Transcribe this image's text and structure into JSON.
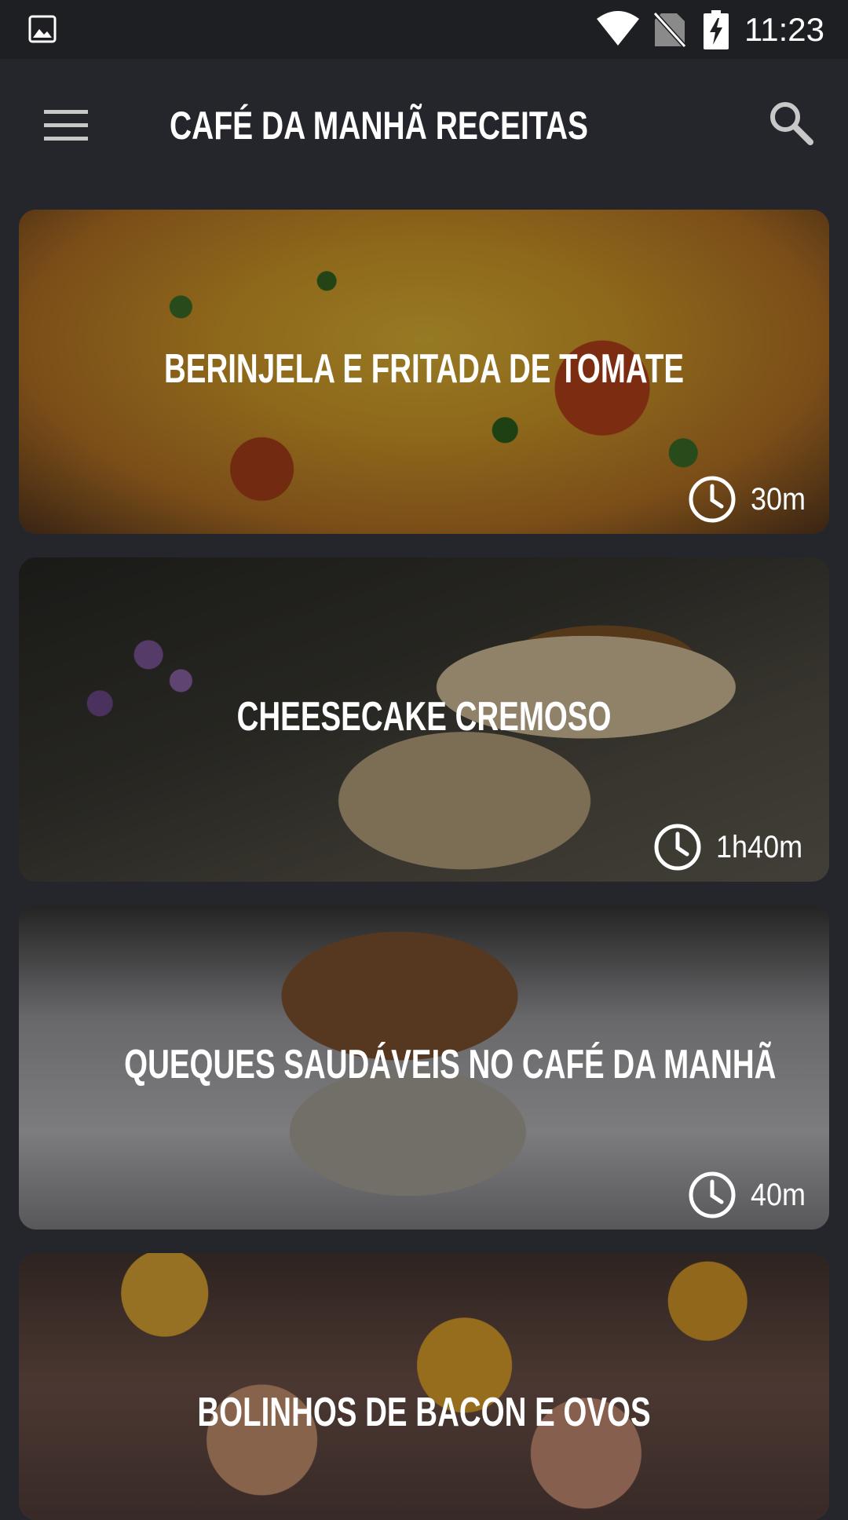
{
  "status_bar": {
    "time": "11:23",
    "icons": [
      "gallery-icon",
      "wifi-icon",
      "no-sim-icon",
      "battery-charging-icon"
    ]
  },
  "app_bar": {
    "title": "CAFÉ DA MANHÃ RECEITAS",
    "menu_icon": "menu-icon",
    "search_icon": "search-icon"
  },
  "recipes": [
    {
      "title": "BERINJELA E FRITADA DE TOMATE",
      "time": "30m"
    },
    {
      "title": "CHEESECAKE CREMOSO",
      "time": "1h40m"
    },
    {
      "title": "QUEQUES SAUDÁVEIS NO CAFÉ DA MANHÃ",
      "time": "40m"
    },
    {
      "title": "BOLINHOS DE BACON E OVOS",
      "time": ""
    }
  ],
  "colors": {
    "background": "#25262c",
    "status_bar": "#1e1f22",
    "text": "#ffffff"
  }
}
